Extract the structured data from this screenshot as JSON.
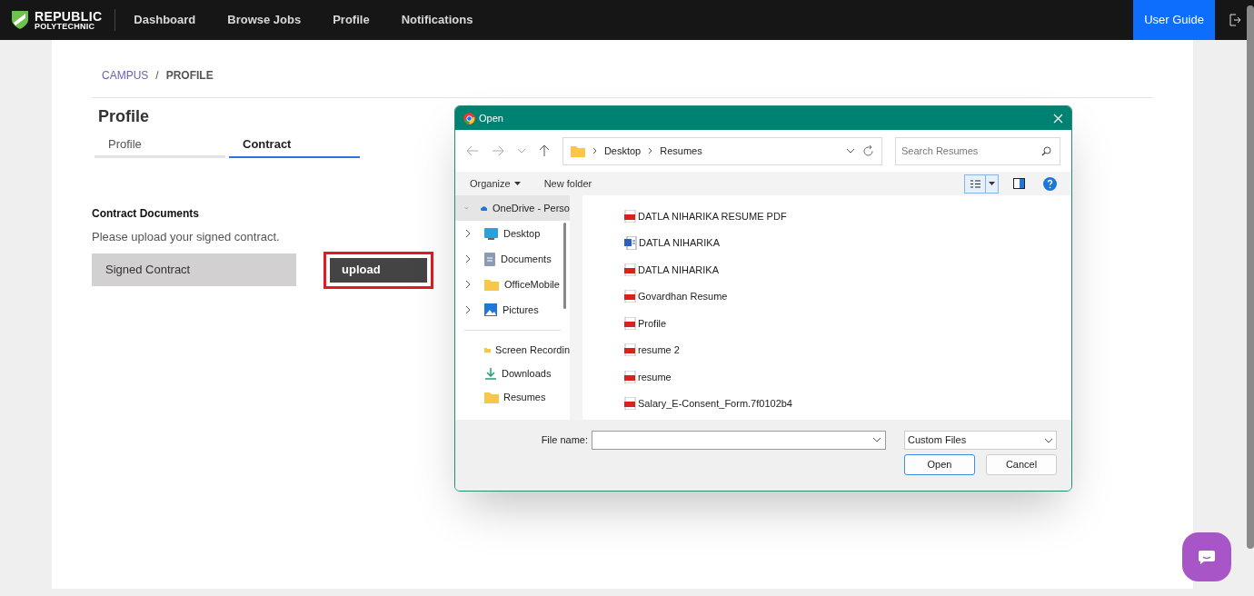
{
  "navbar": {
    "logo_line1": "REPUBLIC",
    "logo_line2": "POLYTECHNIC",
    "links": [
      {
        "label": "Dashboard"
      },
      {
        "label": "Browse Jobs"
      },
      {
        "label": "Profile"
      },
      {
        "label": "Notifications"
      }
    ],
    "user_guide": "User Guide"
  },
  "breadcrumb": [
    "CAMPUS",
    "/",
    "PROFILE"
  ],
  "page_title": "Profile",
  "tabs": [
    {
      "label": "Profile",
      "selected": false
    },
    {
      "label": "Contract",
      "selected": true
    }
  ],
  "contract": {
    "heading": "Contract Documents",
    "hint": "Please upload your signed contract.",
    "document": "Signed Contract",
    "upload_button": "upload"
  },
  "dialog": {
    "title": "Open",
    "path": [
      "Desktop",
      "Resumes"
    ],
    "search": {
      "placeholder": "Search Resumes"
    },
    "details_view_selected": true,
    "organize": "Organize",
    "new_folder": "New folder",
    "nav_tree": [
      {
        "label": "OneDrive - Perso",
        "kind": "cloud",
        "expanded": true,
        "selected": true,
        "children": [
          {
            "label": "Desktop",
            "kind": "desktop",
            "expanded": false,
            "selected": false
          },
          {
            "label": "Documents",
            "kind": "documents",
            "expanded": false,
            "selected": false
          },
          {
            "label": "OfficeMobile",
            "kind": "folder",
            "expanded": false,
            "selected": false
          },
          {
            "label": "Pictures",
            "kind": "pictures",
            "expanded": false,
            "selected": false
          }
        ]
      }
    ],
    "quick_access": [
      {
        "label": "Screen Recordin",
        "kind": "folder"
      },
      {
        "label": "Downloads",
        "kind": "download"
      },
      {
        "label": "Resumes",
        "kind": "folder"
      }
    ],
    "files": [
      {
        "name": "DATLA NIHARIKA RESUME PDF",
        "kind": "pdf"
      },
      {
        "name": "DATLA NIHARIKA",
        "kind": "word"
      },
      {
        "name": "DATLA NIHARIKA",
        "kind": "pdf"
      },
      {
        "name": "Govardhan Resume",
        "kind": "pdf"
      },
      {
        "name": "Profile",
        "kind": "pdf"
      },
      {
        "name": "resume 2",
        "kind": "pdf"
      },
      {
        "name": "resume",
        "kind": "pdf"
      },
      {
        "name": "Salary_E-Consent_Form.7f0102b4",
        "kind": "pdf"
      }
    ],
    "file_name_label": "File name:",
    "file_type": "Custom Files",
    "open_button": "Open",
    "cancel_button": "Cancel"
  }
}
